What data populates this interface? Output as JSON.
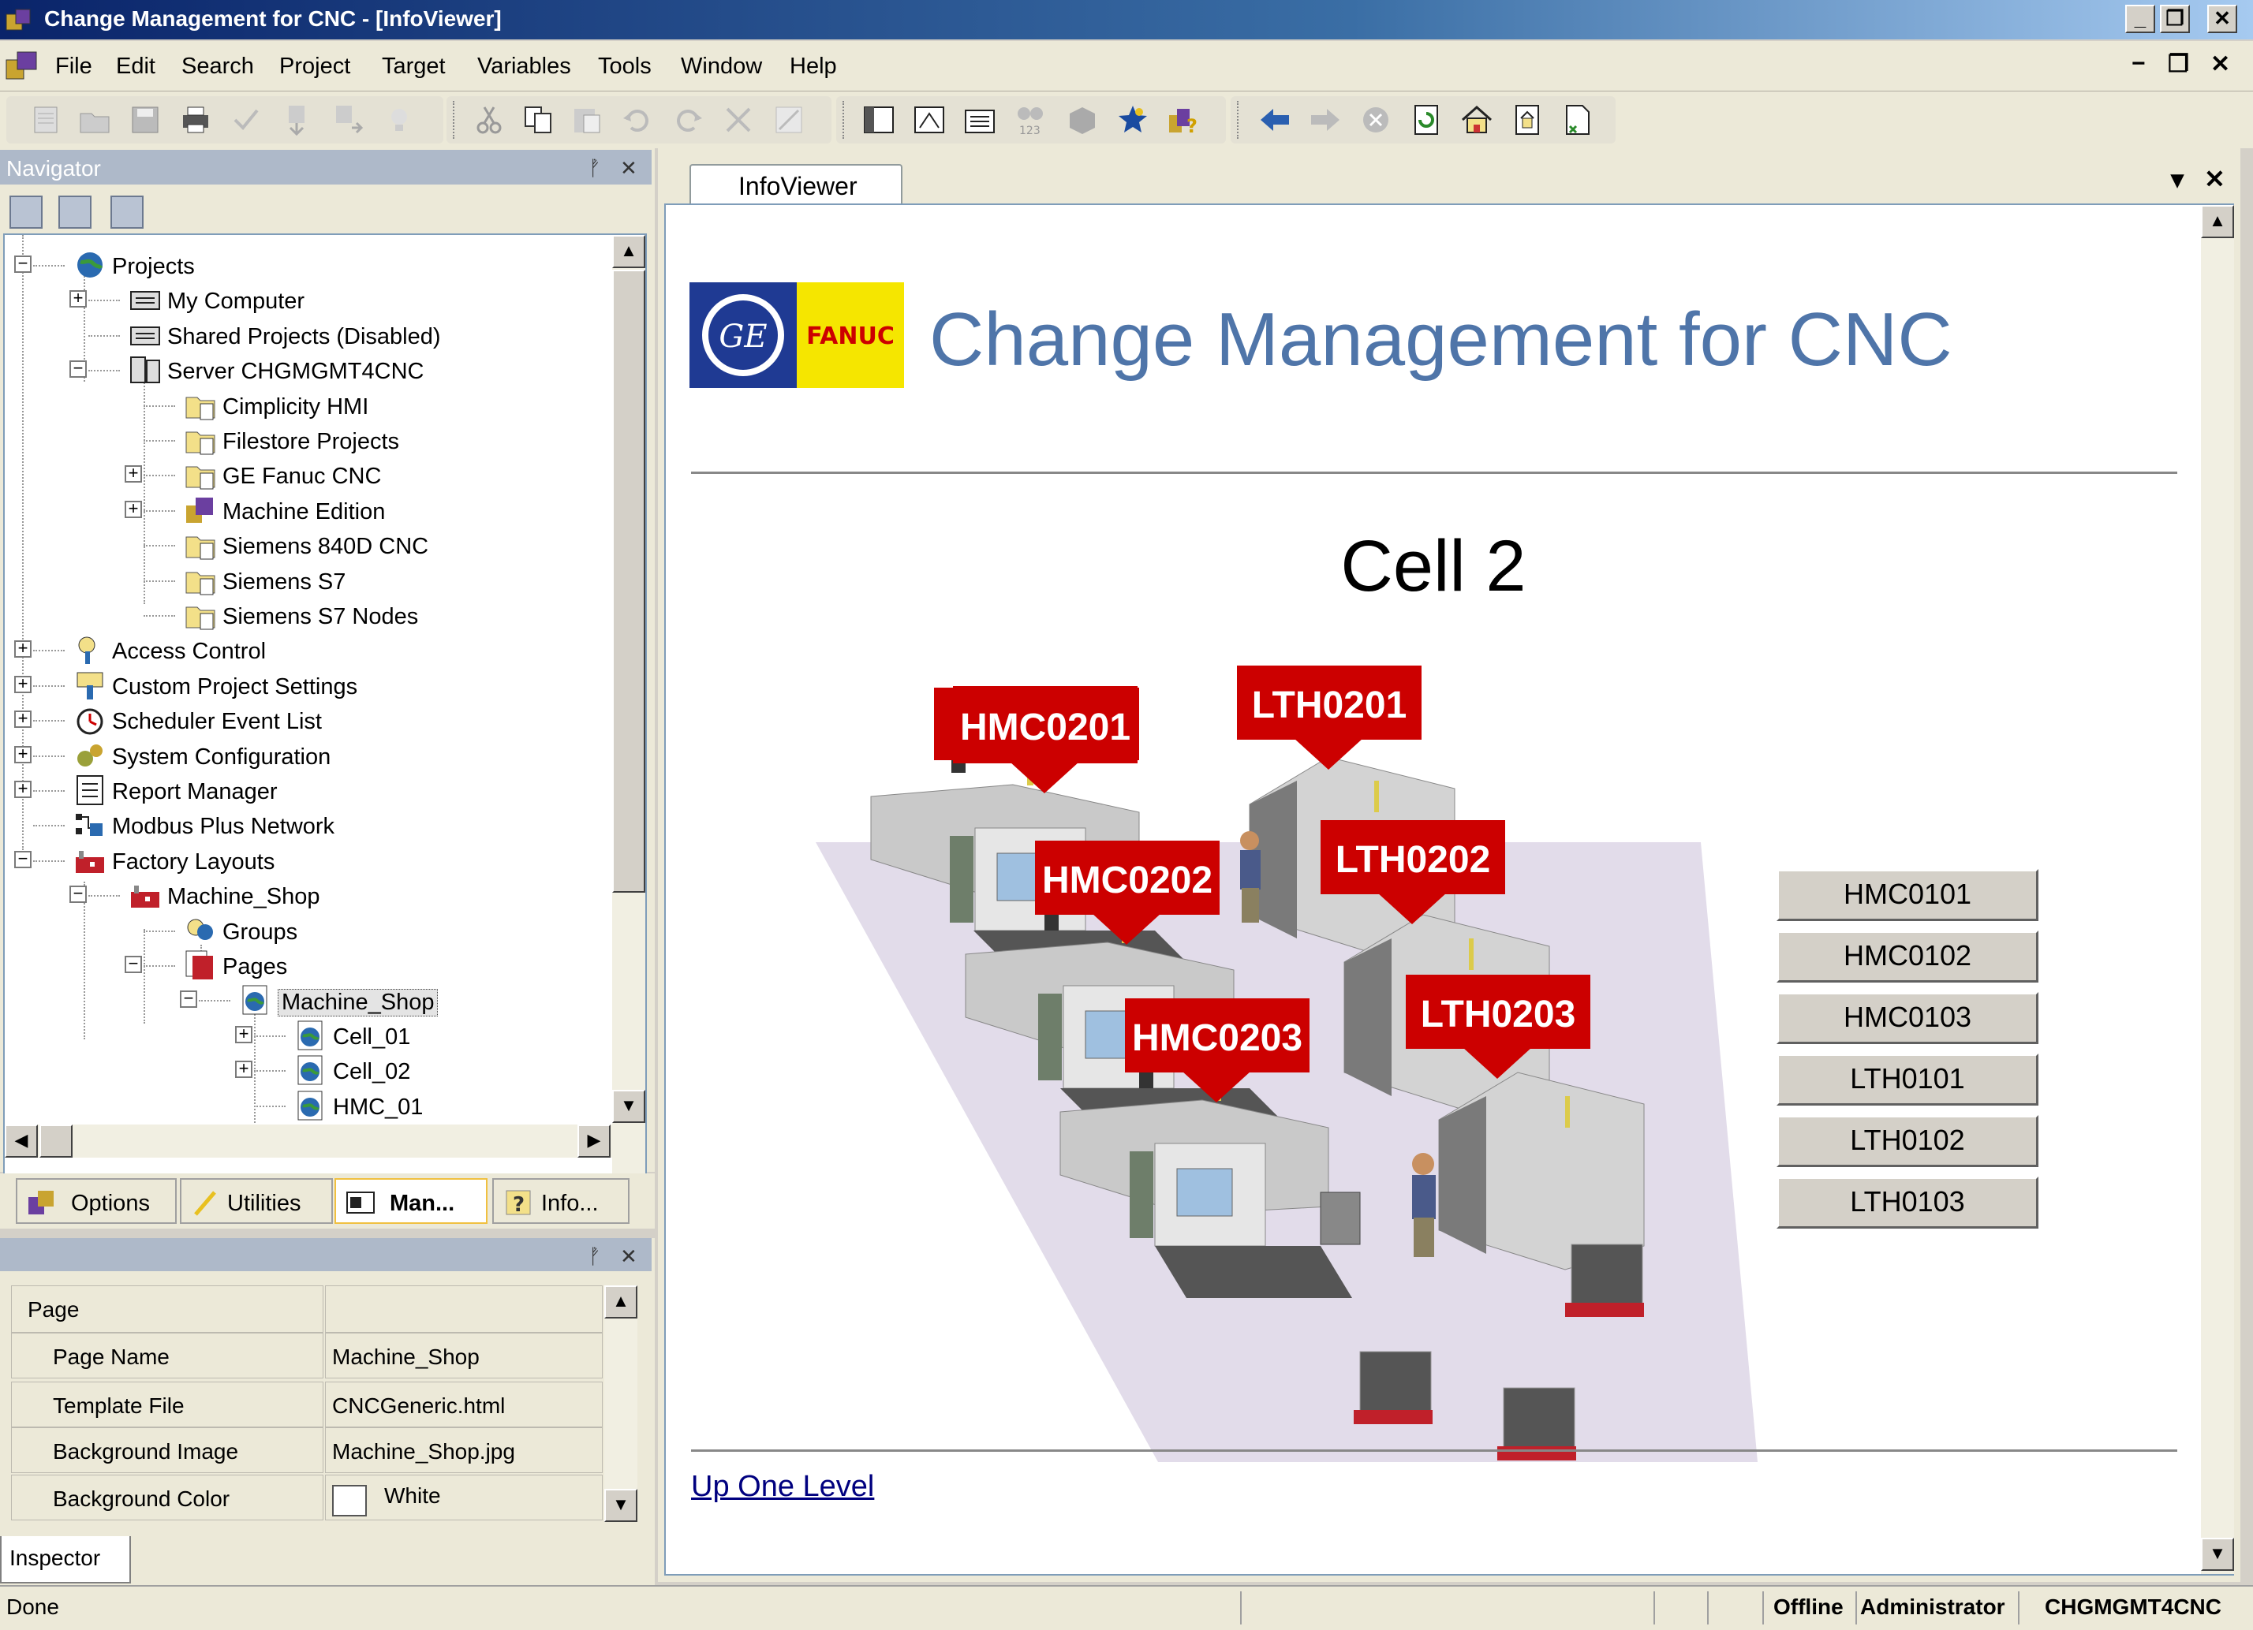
{
  "window": {
    "title": "Change Management for CNC - [InfoViewer]",
    "min_glyph": "_",
    "restore_glyph": "❐",
    "close_glyph": "✕",
    "mdi_min": "−",
    "mdi_restore": "❐",
    "mdi_close": "✕"
  },
  "menu": [
    "File",
    "Edit",
    "Search",
    "Project",
    "Target",
    "Variables",
    "Tools",
    "Window",
    "Help"
  ],
  "toolbar": {
    "icons": [
      "new-project-icon",
      "open-icon",
      "save-icon",
      "print-icon",
      "check-icon",
      "download-icon",
      "upload-icon",
      "lightbulb-icon",
      "cut-icon",
      "copy-icon",
      "paste-icon",
      "undo-icon",
      "redo-icon",
      "delete-icon",
      "properties-icon",
      "navigator-icon",
      "inspector-icon",
      "companion-icon",
      "variables-icon",
      "blocks-icon",
      "star-icon",
      "help-icon",
      "back-icon",
      "forward-icon",
      "stop-icon",
      "refresh-icon",
      "home-icon",
      "page-icon",
      "document-icon"
    ]
  },
  "navigator": {
    "title": "Navigator",
    "pin_glyph": "ᚡ",
    "close_glyph": "✕",
    "tree": [
      {
        "label": "Projects",
        "icon": "globe-icon",
        "level": 0,
        "expander": "−"
      },
      {
        "label": "My Computer",
        "icon": "computer-icon",
        "level": 1,
        "expander": "+"
      },
      {
        "label": "Shared Projects (Disabled)",
        "icon": "computer-icon",
        "level": 1,
        "expander": ""
      },
      {
        "label": "Server CHGMGMT4CNC",
        "icon": "server-icon",
        "level": 1,
        "expander": "−"
      },
      {
        "label": "Cimplicity HMI",
        "icon": "folder-icon",
        "level": 2,
        "expander": ""
      },
      {
        "label": "Filestore Projects",
        "icon": "folder-icon",
        "level": 2,
        "expander": ""
      },
      {
        "label": "GE Fanuc CNC",
        "icon": "folder-icon",
        "level": 2,
        "expander": "+"
      },
      {
        "label": "Machine Edition",
        "icon": "machine-edition-icon",
        "level": 2,
        "expander": "+"
      },
      {
        "label": "Siemens 840D CNC",
        "icon": "folder-icon",
        "level": 2,
        "expander": ""
      },
      {
        "label": "Siemens S7",
        "icon": "folder-icon",
        "level": 2,
        "expander": ""
      },
      {
        "label": "Siemens S7 Nodes",
        "icon": "folder-icon",
        "level": 2,
        "expander": ""
      },
      {
        "label": "Access Control",
        "icon": "access-control-icon",
        "level": 0,
        "expander": "+"
      },
      {
        "label": "Custom Project Settings",
        "icon": "settings-icon",
        "level": 0,
        "expander": "+"
      },
      {
        "label": "Scheduler Event List",
        "icon": "clock-icon",
        "level": 0,
        "expander": "+"
      },
      {
        "label": "System Configuration",
        "icon": "gears-icon",
        "level": 0,
        "expander": "+"
      },
      {
        "label": "Report Manager",
        "icon": "report-icon",
        "level": 0,
        "expander": "+"
      },
      {
        "label": "Modbus Plus Network",
        "icon": "network-icon",
        "level": 0,
        "expander": ""
      },
      {
        "label": "Factory Layouts",
        "icon": "factory-icon",
        "level": 0,
        "expander": "−"
      },
      {
        "label": "Machine_Shop",
        "icon": "factory-icon",
        "level": 1,
        "expander": "−"
      },
      {
        "label": "Groups",
        "icon": "groups-icon",
        "level": 2,
        "expander": ""
      },
      {
        "label": "Pages",
        "icon": "pages-icon",
        "level": 2,
        "expander": "−"
      },
      {
        "label": "Machine_Shop",
        "icon": "globe-page-icon",
        "level": 3,
        "expander": "−",
        "selected": true
      },
      {
        "label": "Cell_01",
        "icon": "globe-page-icon",
        "level": 4,
        "expander": "+"
      },
      {
        "label": "Cell_02",
        "icon": "globe-page-icon",
        "level": 4,
        "expander": "+"
      },
      {
        "label": "HMC_01",
        "icon": "globe-page-icon",
        "level": 4,
        "expander": ""
      }
    ]
  },
  "nav_tabs": [
    {
      "label": "Options",
      "icon": "options-icon",
      "active": false
    },
    {
      "label": "Utilities",
      "icon": "utilities-icon",
      "active": false
    },
    {
      "label": "Man...",
      "icon": "manager-icon",
      "active": true
    },
    {
      "label": "Info...",
      "icon": "info-icon",
      "active": false
    }
  ],
  "inspector": {
    "tab": "Inspector",
    "header": "Page",
    "rows": [
      {
        "name": "Page Name",
        "value": "Machine_Shop"
      },
      {
        "name": "Template File",
        "value": "CNCGeneric.html"
      },
      {
        "name": "Background Image",
        "value": "Machine_Shop.jpg"
      },
      {
        "name": "Background Color",
        "value": "White",
        "swatch": "#ffffff"
      }
    ]
  },
  "status": {
    "left": "Done",
    "mode": "Offline",
    "user": "Administrator",
    "server": "CHGMGMT4CNC"
  },
  "infoviewer": {
    "tab": "InfoViewer",
    "dropdown_glyph": "▾",
    "close_glyph": "✕",
    "logo_fanuc": "FANUC",
    "logo_ge": "GE",
    "page_title": "Change Management for CNC",
    "cell_heading": "Cell 2",
    "machine_labels": [
      "HMC0201",
      "LTH0201",
      "HMC0202",
      "LTH0202",
      "HMC0203",
      "LTH0203"
    ],
    "side_buttons": [
      "HMC0101",
      "HMC0102",
      "HMC0103",
      "LTH0101",
      "LTH0102",
      "LTH0103"
    ],
    "up_link": "Up One Level",
    "colors": {
      "title_blue": "#4f75a9",
      "label_red": "#cc0000",
      "floor": "#e2dcea"
    }
  }
}
